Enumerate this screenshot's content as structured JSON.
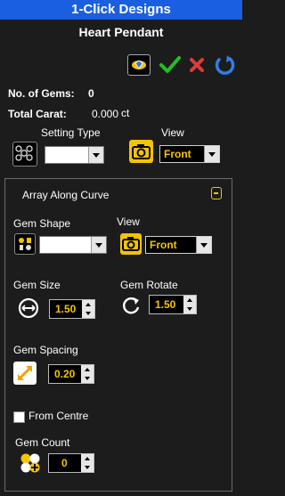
{
  "window": {
    "title": "1-Click Designs",
    "subtitle": "Heart Pendant"
  },
  "colors": {
    "title_bar": "#1a5fe0",
    "accent_value": "#f5c400",
    "icon_yellow": "#f5c400"
  },
  "toolbar": {
    "icons": [
      "gem-view-icon",
      "check-icon",
      "close-icon",
      "refresh-icon"
    ]
  },
  "stats": {
    "gems_label": "No. of Gems:",
    "gems_value": "0",
    "carat_label": "Total Carat:",
    "carat_value": "0.000",
    "carat_unit": "ct"
  },
  "setting": {
    "type_label": "Setting Type",
    "type_value": "",
    "view_label": "View",
    "view_value": "Front"
  },
  "array": {
    "title": "Array Along Curve",
    "shape_label": "Gem Shape",
    "shape_value": "",
    "view_label": "View",
    "view_value": "Front",
    "size_label": "Gem Size",
    "size_value": "1.50",
    "rotate_label": "Gem Rotate",
    "rotate_value": "1.50",
    "spacing_label": "Gem Spacing",
    "spacing_value": "0.20",
    "from_centre_label": "From Centre",
    "count_label": "Gem Count",
    "count_value": "0"
  }
}
